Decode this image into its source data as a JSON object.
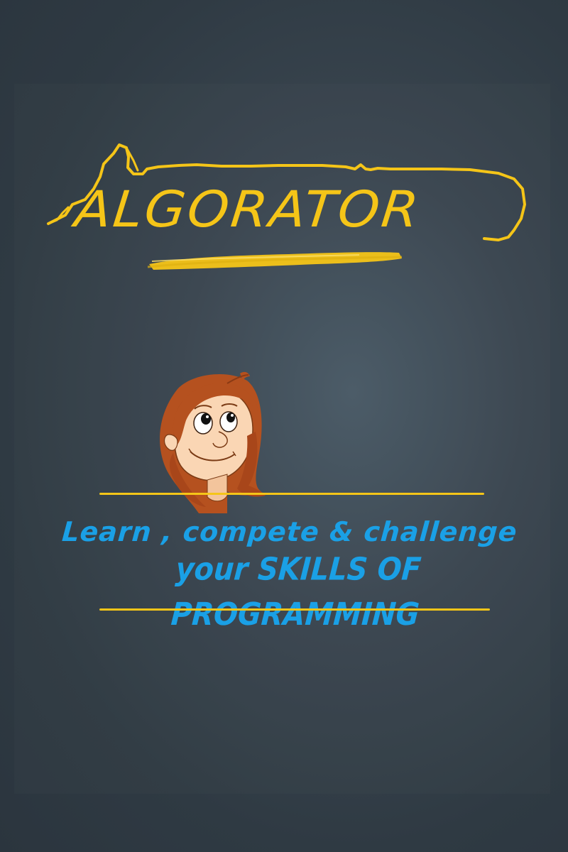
{
  "logo": {
    "text": "ALGORATOR",
    "color": "#f5c518"
  },
  "mascot": {
    "icon": "girl-mascot-icon"
  },
  "tagline": {
    "line1": "Learn , compete & challenge",
    "line2": "your SKILLS OF PROGRAMMING",
    "color": "#1aa0e6"
  },
  "accent_color": "#f5c518"
}
